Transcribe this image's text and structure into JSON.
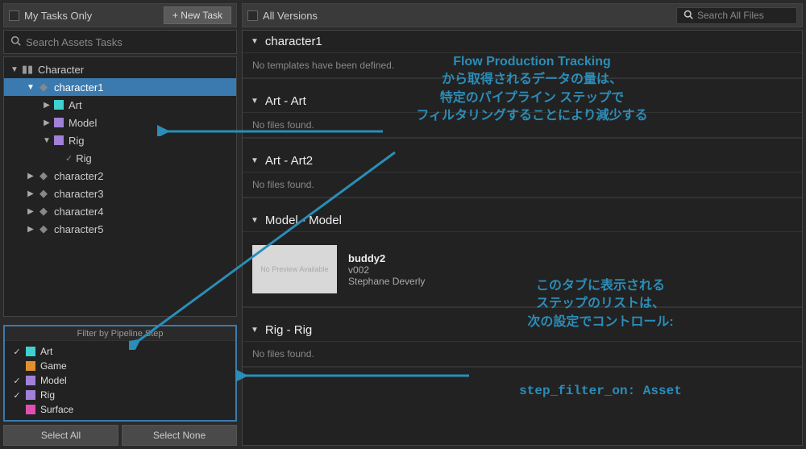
{
  "left": {
    "header_label": "My Tasks Only",
    "new_task_label": "+ New Task",
    "search_placeholder": "Search Assets Tasks"
  },
  "tree": {
    "root": "Character",
    "items": [
      {
        "label": "character1"
      },
      {
        "label": "Art",
        "swatch": "cyan"
      },
      {
        "label": "Model",
        "swatch": "purple"
      },
      {
        "label": "Rig",
        "swatch": "purple"
      },
      {
        "label": "Rig"
      },
      {
        "label": "character2"
      },
      {
        "label": "character3"
      },
      {
        "label": "character4"
      },
      {
        "label": "character5"
      }
    ]
  },
  "filter": {
    "title": "Filter by Pipeline Step",
    "items": [
      {
        "label": "Art",
        "swatch": "cyan",
        "checked": true
      },
      {
        "label": "Game",
        "swatch": "orange",
        "checked": false
      },
      {
        "label": "Model",
        "swatch": "purple",
        "checked": true
      },
      {
        "label": "Rig",
        "swatch": "purple",
        "checked": true
      },
      {
        "label": "Surface",
        "swatch": "pink",
        "checked": false
      }
    ],
    "select_all": "Select All",
    "select_none": "Select None"
  },
  "right": {
    "header_label": "All Versions",
    "search_placeholder": "Search All Files",
    "sections": [
      {
        "title": "character1",
        "body": "No templates have been defined."
      },
      {
        "title": "Art - Art",
        "body": "No files found."
      },
      {
        "title": "Art - Art2",
        "body": "No files found."
      },
      {
        "title": "Model - Model",
        "file": {
          "name": "buddy2",
          "version": "v002",
          "author": "Stephane Deverly",
          "thumb": "No Preview Available"
        }
      },
      {
        "title": "Rig - Rig",
        "body": "No files found."
      }
    ]
  },
  "annotations": {
    "top": "Flow Production Tracking\nから取得されるデータの量は、\n特定のパイプライン ステップで\nフィルタリングすることにより減少する",
    "mid": "このタブに表示される\nステップのリストは、\n次の設定でコントロール:",
    "code": "step_filter_on: Asset"
  }
}
